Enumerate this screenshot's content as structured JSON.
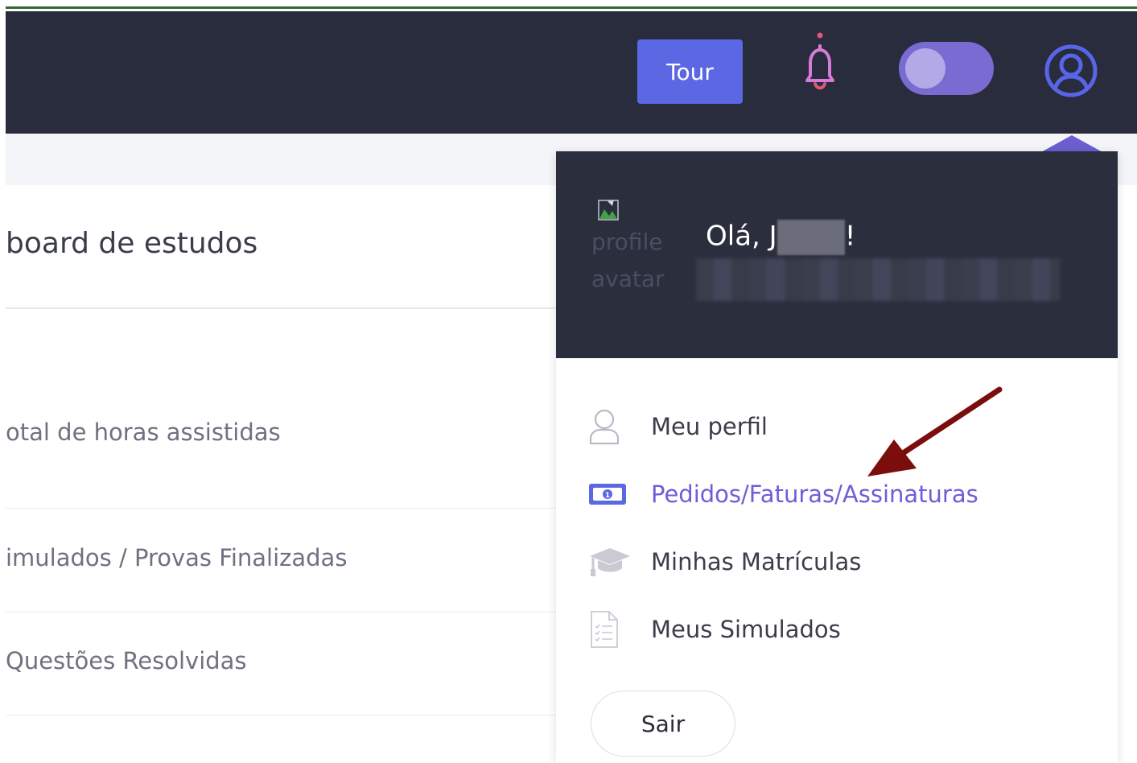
{
  "header": {
    "tour_label": "Tour",
    "notification_dot_color": "#e0567a",
    "accent": "#5b67e3"
  },
  "page": {
    "title": "board de estudos",
    "stats": [
      "otal de horas assistidas",
      "imulados / Provas Finalizadas",
      "Questões Resolvidas"
    ]
  },
  "profile_menu": {
    "avatar_alt": "profile avatar",
    "greeting_prefix": "Olá, J",
    "greeting_suffix": "!",
    "items": [
      {
        "label": "Meu perfil",
        "icon": "user-icon"
      },
      {
        "label": "Pedidos/Faturas/Assinaturas",
        "icon": "money-bill-icon",
        "active": true
      },
      {
        "label": "Minhas Matrículas",
        "icon": "graduation-cap-icon"
      },
      {
        "label": "Meus Simulados",
        "icon": "document-checklist-icon"
      }
    ],
    "logout_label": "Sair"
  },
  "annotation": {
    "color": "#7b0d0d"
  }
}
